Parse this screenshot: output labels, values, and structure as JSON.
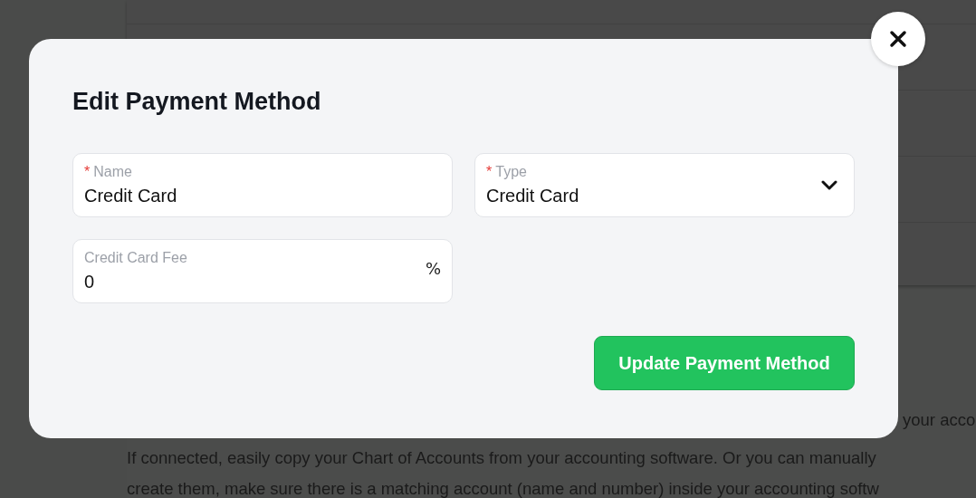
{
  "background": {
    "text_lines": [
      "your acco",
      "If connected, easily copy your Chart of Accounts from your accounting software. Or you can manually",
      "create them, make sure there is a matching account (name and number) inside your accounting softw"
    ]
  },
  "dialog": {
    "title": "Edit Payment Method",
    "fields": [
      {
        "kind": "text",
        "required_mark": "*",
        "label": "Name",
        "value": "Credit Card"
      },
      {
        "kind": "select",
        "required_mark": "*",
        "label": "Type",
        "value": "Credit Card"
      },
      {
        "kind": "suffix",
        "label": "Credit Card Fee",
        "value": "0",
        "suffix": "%"
      }
    ],
    "submit_button": "Update Payment Method"
  }
}
